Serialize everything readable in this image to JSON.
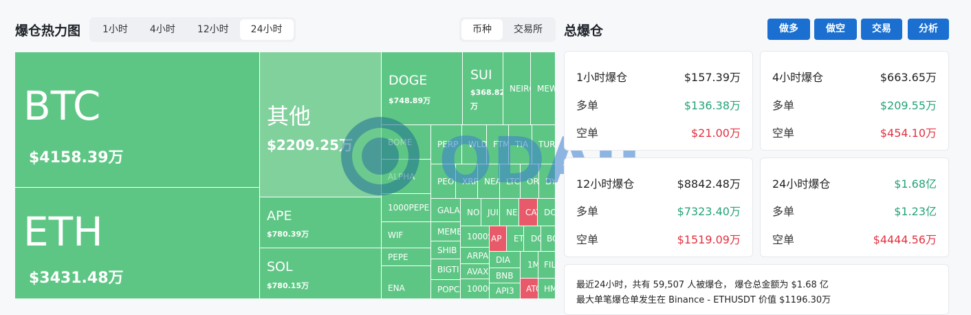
{
  "header": {
    "title": "爆仓热力图",
    "time_options": [
      "1小时",
      "4小时",
      "12小时",
      "24小时"
    ],
    "time_selected": "24小时",
    "view_options": [
      "币种",
      "交易所"
    ],
    "view_selected": "币种"
  },
  "treemap": {
    "big": [
      {
        "name": "BTC",
        "value": "$4158.39万"
      },
      {
        "name": "ETH",
        "value": "$3431.48万"
      },
      {
        "name": "其他",
        "value": "$2209.25万"
      },
      {
        "name": "APE",
        "value": "$780.39万"
      },
      {
        "name": "SOL",
        "value": "$780.15万"
      },
      {
        "name": "DOGE",
        "value": "$748.89万"
      },
      {
        "name": "SUI",
        "value": "$368.82万",
        "value_line1": "$368.82",
        "value_line2": "万"
      }
    ],
    "small": {
      "NEIRO": "NEIRO",
      "MEW": "MEW",
      "BOME": "BOME",
      "PERP": "PERP",
      "WLD": "WLD",
      "FTM": "FTM",
      "TIA": "TIA",
      "TURBO": "TUR",
      "ALPHA": "ALPHA",
      "PEOPLE": "PEO",
      "XRP": "XRP",
      "NEAR": "NEA",
      "LTC": "LTC",
      "ORDI": "ORD",
      "DYDX": "DYI",
      "1000PEPE": "1000PEPE",
      "GALA": "GALA",
      "NOT": "NO",
      "JUP": "JUI",
      "NEO": "NE",
      "CATI": "CAT",
      "DOT": "DO",
      "WIF": "WIF",
      "MEME": "MEME",
      "1000S": "1000S",
      "APT": "AP",
      "ETC": "ET",
      "DOGS": "DC",
      "BOME2": "BO",
      "SHIB": "SHIB",
      "ARPA": "ARPA",
      "DIA": "DIA",
      "1M": "1M",
      "FIL": "FIL",
      "PEPE": "PEPE",
      "BIGTIME": "BIGTI",
      "AVAX": "AVAX",
      "BNB": "BNB",
      "ENA": "ENA",
      "POPCAT": "POPCA",
      "10000": "10000",
      "API3": "API3",
      "ATOM": "ATC",
      "HMSTR": "HM"
    }
  },
  "panel": {
    "title": "总爆仓",
    "buttons": [
      "做多",
      "做空",
      "交易",
      "分析"
    ],
    "cards": [
      {
        "period": "1小时爆仓",
        "total": "$157.39万",
        "long_label": "多单",
        "long": "$136.38万",
        "short_label": "空单",
        "short": "$21.00万"
      },
      {
        "period": "4小时爆仓",
        "total": "$663.65万",
        "long_label": "多单",
        "long": "$209.55万",
        "short_label": "空单",
        "short": "$454.10万"
      },
      {
        "period": "12小时爆仓",
        "total": "$8842.48万",
        "long_label": "多单",
        "long": "$7323.40万",
        "short_label": "空单",
        "short": "$1519.09万"
      },
      {
        "period": "24小时爆仓",
        "total": "$1.68亿",
        "long_label": "多单",
        "long": "$1.23亿",
        "short_label": "空单",
        "short": "$4444.56万"
      }
    ],
    "note_line1": "最近24小时，共有 59,507 人被爆仓， 爆仓总金额为 $1.68 亿",
    "note_line2": "最大单笔爆仓单发生在 Binance - ETHUSDT 价值 $1196.30万"
  },
  "watermark": {
    "text": "ODAILY"
  },
  "colors": {
    "green_cell": "#5ec684",
    "light_green_cell": "#80d19c",
    "red_cell": "#e85a6a",
    "button_blue": "#1a6fd0",
    "long_green": "#25a277",
    "short_red": "#e2303f"
  }
}
